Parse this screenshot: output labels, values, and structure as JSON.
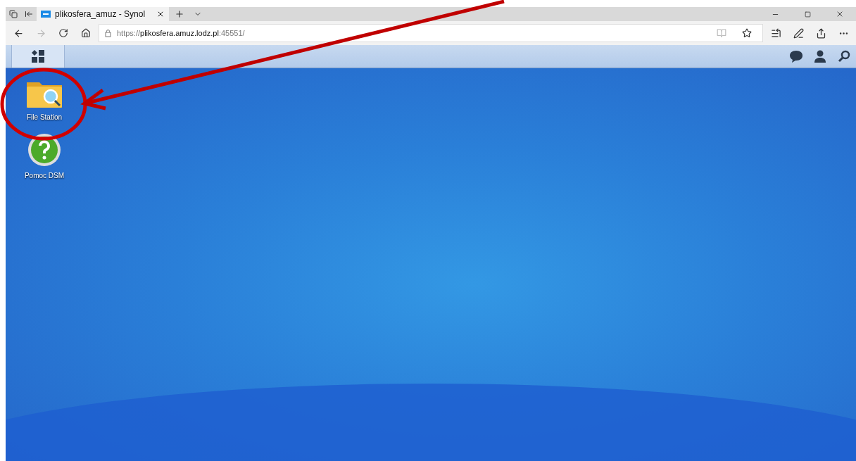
{
  "browser": {
    "tab": {
      "title": "plikosfera_amuz - Synol",
      "selected": true
    },
    "address": {
      "scheme": "https://",
      "host": "plikosfera.amuz.lodz.pl",
      "port": ":45551/"
    }
  },
  "desktop": {
    "icons": [
      {
        "kind": "folder",
        "label": "File Station"
      },
      {
        "kind": "help",
        "label": "Pomoc DSM"
      }
    ]
  }
}
